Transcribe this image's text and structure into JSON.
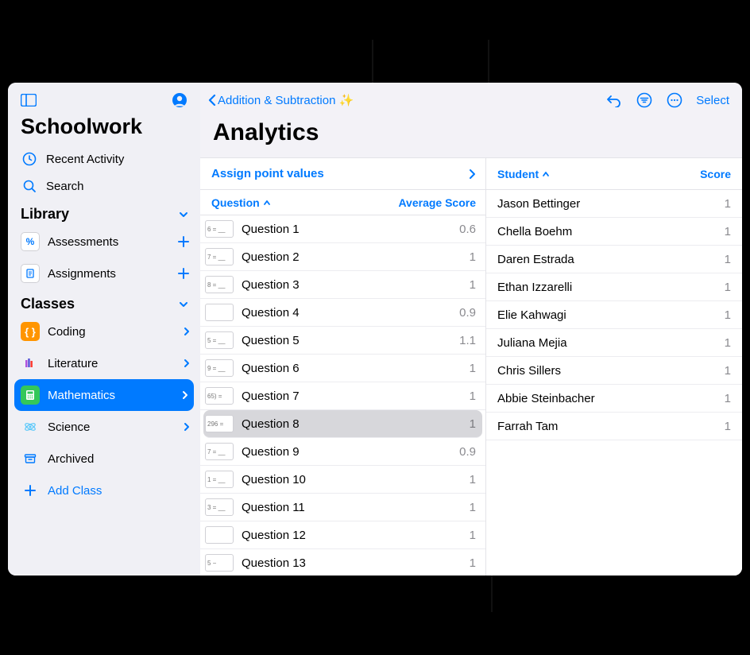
{
  "accent": "#007aff",
  "app_title": "Schoolwork",
  "sidebar": {
    "recent": "Recent Activity",
    "search": "Search",
    "library": {
      "title": "Library",
      "items": [
        {
          "label": "Assessments"
        },
        {
          "label": "Assignments"
        }
      ]
    },
    "classes": {
      "title": "Classes",
      "items": [
        {
          "label": "Coding"
        },
        {
          "label": "Literature"
        },
        {
          "label": "Mathematics",
          "selected": true
        },
        {
          "label": "Science"
        },
        {
          "label": "Archived"
        }
      ],
      "add_label": "Add Class"
    }
  },
  "nav": {
    "back_label": "Addition & Subtraction ✨",
    "select_label": "Select"
  },
  "page_title": "Analytics",
  "questions_panel": {
    "assign_label": "Assign point values",
    "col_question": "Question",
    "col_score": "Average Score",
    "rows": [
      {
        "thumb": "6 = __",
        "label": "Question 1",
        "score": "0.6"
      },
      {
        "thumb": "7 = __",
        "label": "Question 2",
        "score": "1"
      },
      {
        "thumb": "8 = __",
        "label": "Question 3",
        "score": "1"
      },
      {
        "thumb": "",
        "label": "Question 4",
        "score": "0.9"
      },
      {
        "thumb": "5 = __",
        "label": "Question 5",
        "score": "1.1"
      },
      {
        "thumb": "9 = __",
        "label": "Question 6",
        "score": "1"
      },
      {
        "thumb": "65) =",
        "label": "Question 7",
        "score": "1"
      },
      {
        "thumb": "296 =",
        "label": "Question 8",
        "score": "1",
        "selected": true
      },
      {
        "thumb": "7 = __",
        "label": "Question 9",
        "score": "0.9"
      },
      {
        "thumb": "1 = __",
        "label": "Question 10",
        "score": "1"
      },
      {
        "thumb": "3 = __",
        "label": "Question 11",
        "score": "1"
      },
      {
        "thumb": "",
        "label": "Question 12",
        "score": "1"
      },
      {
        "thumb": "5 −",
        "label": "Question 13",
        "score": "1"
      }
    ]
  },
  "students_panel": {
    "col_student": "Student",
    "col_score": "Score",
    "rows": [
      {
        "name": "Jason Bettinger",
        "score": "1"
      },
      {
        "name": "Chella Boehm",
        "score": "1"
      },
      {
        "name": "Daren Estrada",
        "score": "1"
      },
      {
        "name": "Ethan Izzarelli",
        "score": "1"
      },
      {
        "name": "Elie Kahwagi",
        "score": "1"
      },
      {
        "name": "Juliana Mejia",
        "score": "1"
      },
      {
        "name": "Chris Sillers",
        "score": "1"
      },
      {
        "name": "Abbie Steinbacher",
        "score": "1"
      },
      {
        "name": "Farrah Tam",
        "score": "1"
      }
    ]
  }
}
